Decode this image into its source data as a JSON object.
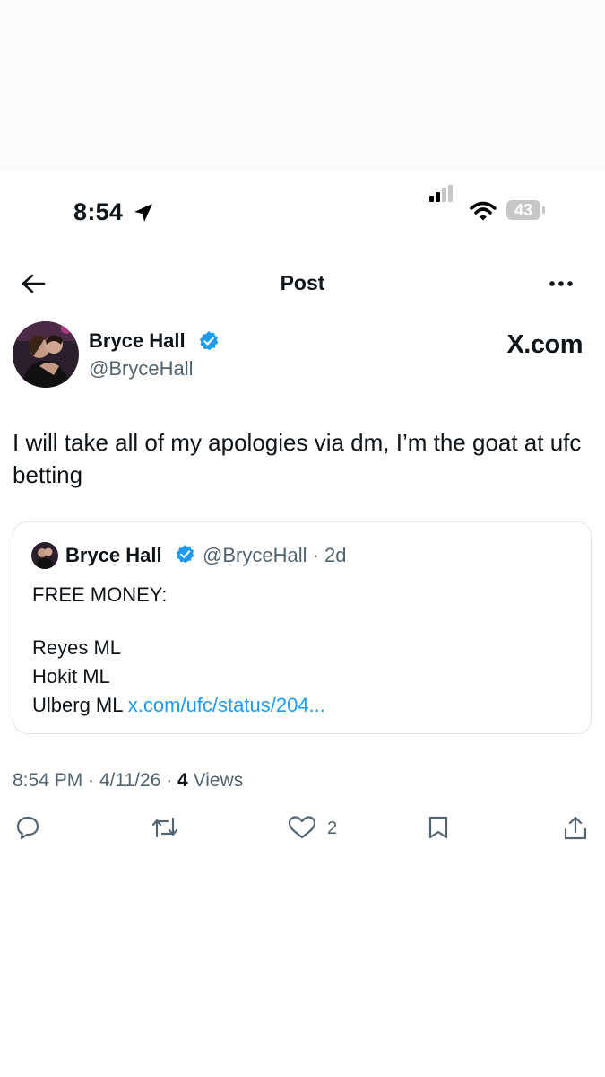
{
  "status_bar": {
    "time": "8:54",
    "battery": "43"
  },
  "header": {
    "title": "Post"
  },
  "post": {
    "author_name": "Bryce Hall",
    "author_handle": "@BryceHall",
    "watermark": "X.com",
    "text": "I will take all of my apologies via dm, I’m the goat at ufc betting",
    "timestamp": "8:54 PM · 4/11/26 · ",
    "views_count": "4",
    "views_label": " Views"
  },
  "quoted_post": {
    "author_name": "Bryce Hall",
    "author_handle": "@BryceHall",
    "separator": " · ",
    "age": "2d",
    "lines": [
      "FREE MONEY:",
      "Reyes ML",
      "Hokit ML",
      "Ulberg ML "
    ],
    "link": "x.com/ufc/status/204..."
  },
  "actions": {
    "reply_icon": "reply-icon",
    "repost_icon": "repost-icon",
    "like_icon": "heart-icon",
    "like_count": "2",
    "bookmark_icon": "bookmark-icon",
    "share_icon": "share-icon"
  },
  "colors": {
    "accent": "#1d9bf0",
    "secondary_text": "#536471",
    "text": "#0f1419"
  }
}
